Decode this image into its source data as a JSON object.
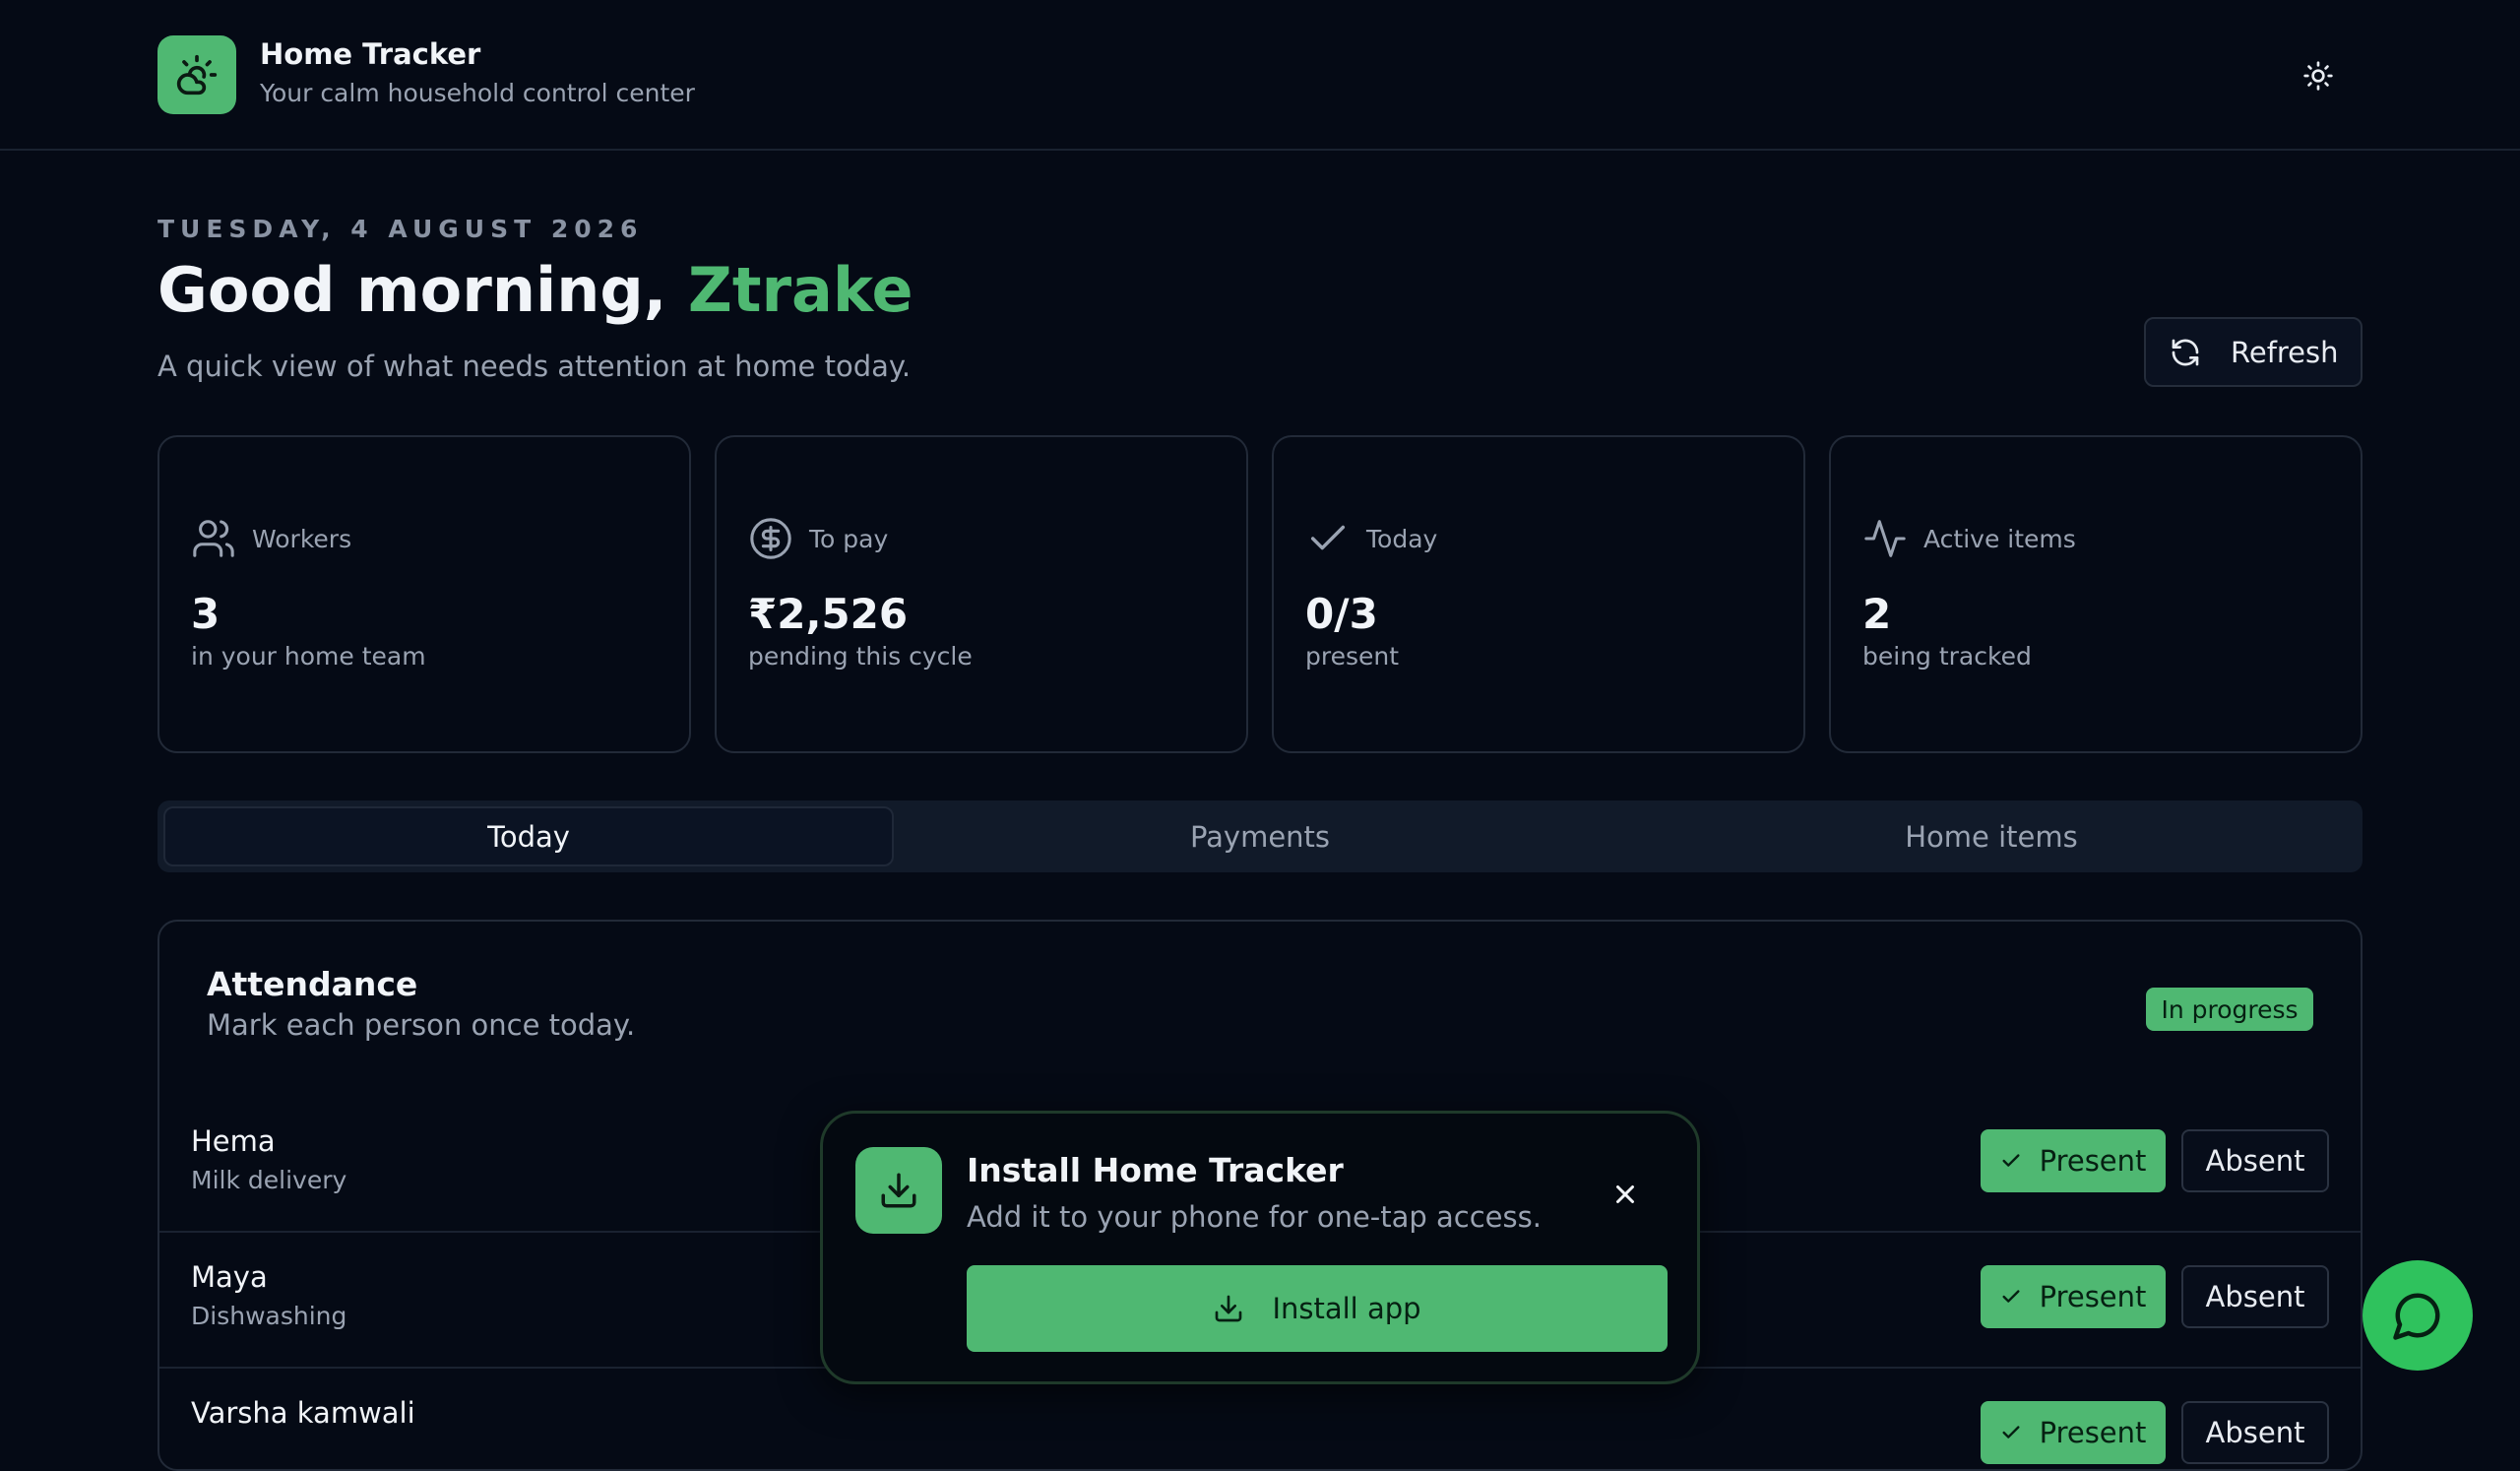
{
  "header": {
    "title": "Home Tracker",
    "subtitle": "Your calm household control center",
    "logo_icon": "sun-cloud-icon",
    "theme_icon": "sun-icon"
  },
  "greeting": {
    "date": "TUESDAY, 4 AUGUST 2026",
    "prefix": "Good morning, ",
    "name": "Ztrake",
    "subtitle": "A quick view of what needs attention at home today."
  },
  "refresh": {
    "label": "Refresh",
    "icon": "refresh-icon"
  },
  "stats": [
    {
      "label": "Workers",
      "value": "3",
      "note": "in your home team",
      "icon": "users-icon"
    },
    {
      "label": "To pay",
      "value": "₹2,526",
      "note": "pending this cycle",
      "icon": "dollar-circle-icon"
    },
    {
      "label": "Today",
      "value": "0/3",
      "note": "present",
      "icon": "check-icon"
    },
    {
      "label": "Active items",
      "value": "2",
      "note": "being tracked",
      "icon": "activity-icon"
    }
  ],
  "tabs": [
    {
      "label": "Today",
      "active": true
    },
    {
      "label": "Payments",
      "active": false
    },
    {
      "label": "Home items",
      "active": false
    }
  ],
  "attendance": {
    "title": "Attendance",
    "subtitle": "Mark each person once today.",
    "status": "In progress",
    "present_label": "Present",
    "absent_label": "Absent",
    "rows": [
      {
        "name": "Hema",
        "role": "Milk delivery"
      },
      {
        "name": "Maya",
        "role": "Dishwashing"
      },
      {
        "name": "Varsha kamwali",
        "role": ""
      }
    ]
  },
  "install": {
    "title": "Install Home Tracker",
    "subtitle": "Add it to your phone for one-tap access.",
    "button_label": "Install app",
    "icon": "download-icon",
    "close_icon": "close-icon"
  },
  "chat": {
    "icon": "chat-bubble-icon"
  },
  "colors": {
    "background": "#050a15",
    "accent": "#4fb872",
    "fab": "#2fc25d"
  }
}
